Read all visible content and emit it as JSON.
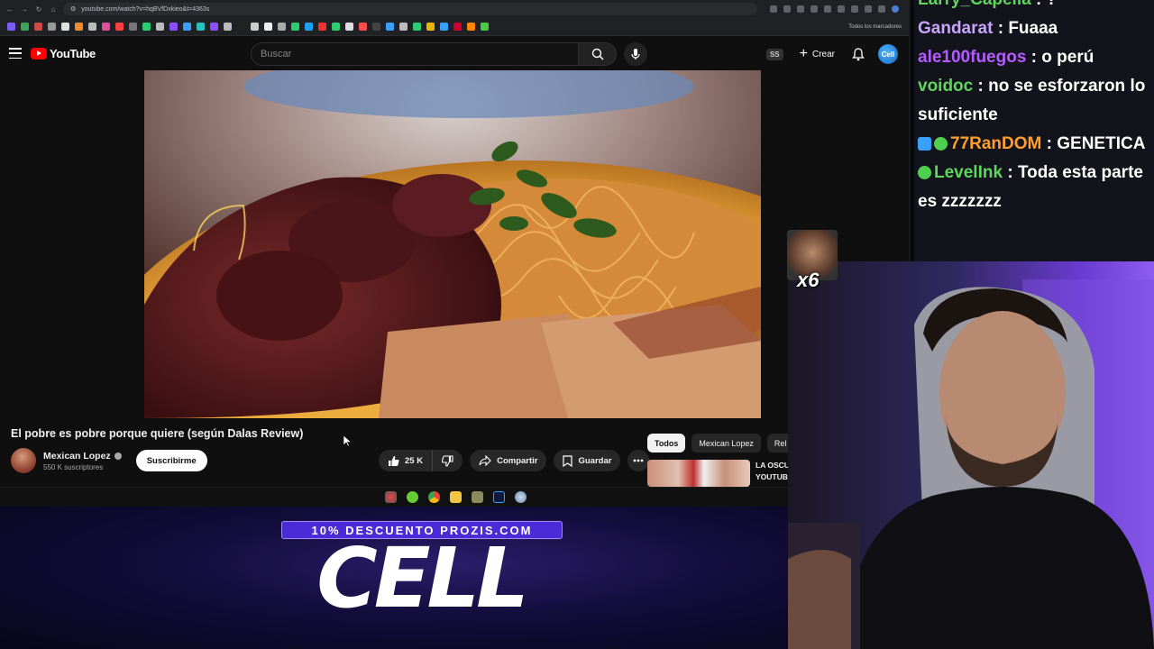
{
  "browser": {
    "url": "youtube.com/watch?v=hqBVfDxkieo&t=4363s",
    "bookmarks_label": "Todos los marcadores"
  },
  "youtube": {
    "logo_text": "YouTube",
    "search_placeholder": "Buscar",
    "ss_badge": "SS",
    "create_label": "Crear",
    "avatar_text": "Cell"
  },
  "video": {
    "title": "El pobre es pobre porque quiere (según Dalas Review)",
    "channel": "Mexican Lopez",
    "subscribers": "550 K suscriptores",
    "subscribe_label": "Suscribirme",
    "likes": "25 K",
    "share_label": "Compartir",
    "save_label": "Guardar"
  },
  "chips": [
    "Todos",
    "Mexican Lopez",
    "Rel"
  ],
  "recommendation": {
    "title": "LA OSCU\nYOUTUB"
  },
  "sponsor": {
    "banner": "10% DESCUENTO PROZIS.COM",
    "logo": "CELL"
  },
  "chat": {
    "messages": [
      {
        "user": "Larry_Capella",
        "text": "?",
        "color": "#5fd45f"
      },
      {
        "user": "Gandarat",
        "text": "Fuaaa",
        "color": "#c9a4ff"
      },
      {
        "user": "ale100fuegos",
        "text": "o perú",
        "color": "#b45cff"
      },
      {
        "user": "voidoc",
        "text": "no se esforzaron lo suficiente",
        "color": "#5fd45f"
      },
      {
        "user": "77RanDOM",
        "text": "GENETICA",
        "color": "#ff9f2e"
      },
      {
        "user": "LevelInk",
        "text": "Toda esta parte es zzzzzzz",
        "color": "#5fd45f"
      }
    ]
  },
  "emote": {
    "count": "x6"
  }
}
